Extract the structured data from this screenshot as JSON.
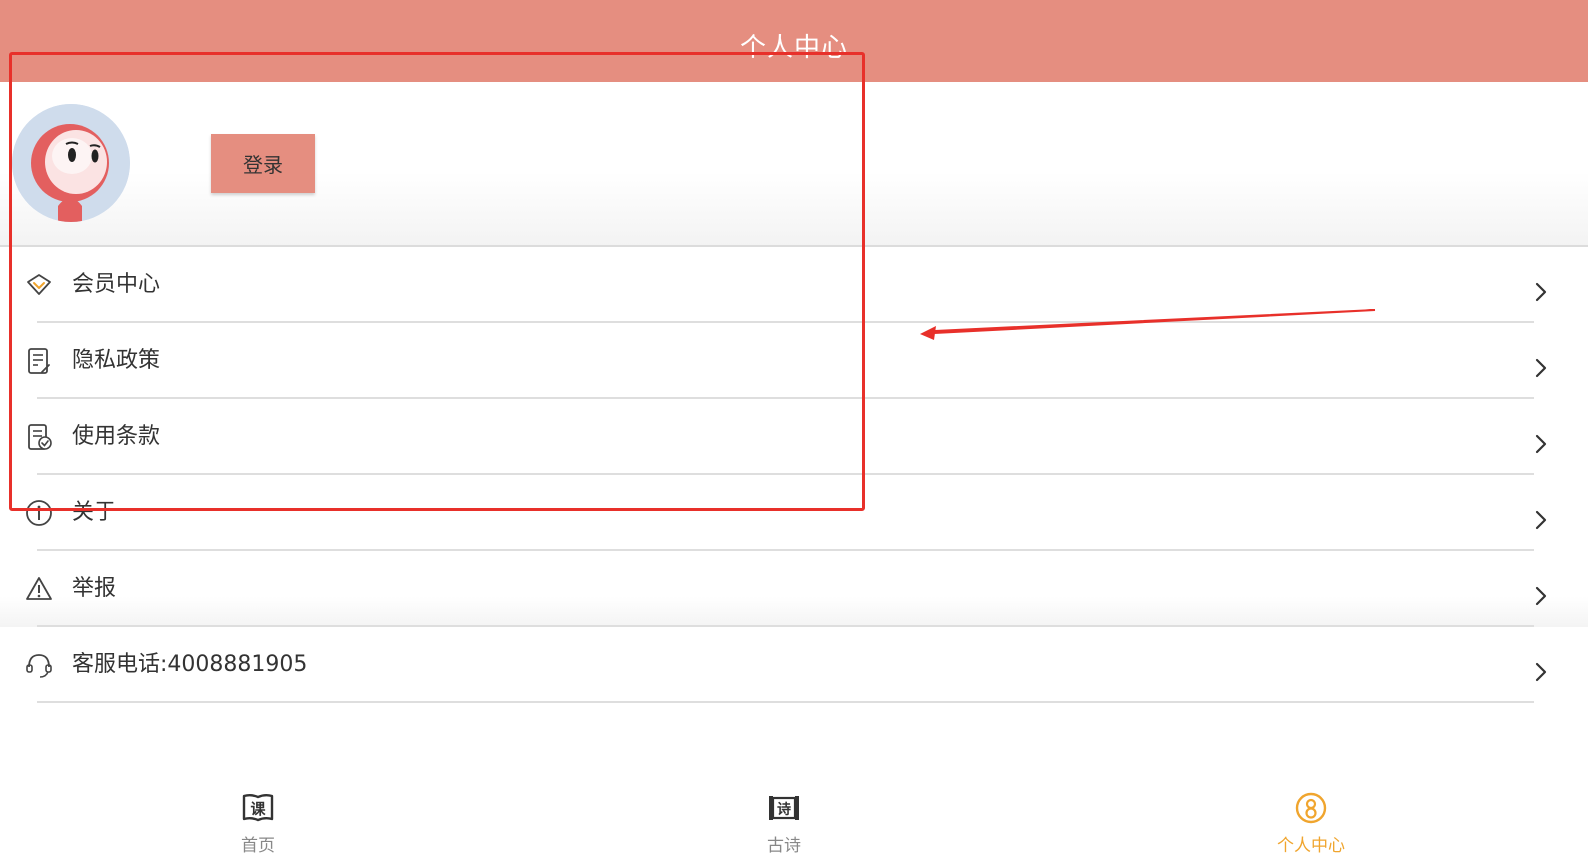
{
  "header": {
    "title": "个人中心"
  },
  "profile": {
    "login_label": "登录"
  },
  "menu": [
    {
      "label": "会员中心",
      "icon": "diamond-icon"
    },
    {
      "label": "隐私政策",
      "icon": "document-icon"
    },
    {
      "label": "使用条款",
      "icon": "document-check-icon"
    },
    {
      "label": "关于",
      "icon": "info-icon"
    },
    {
      "label": "举报",
      "icon": "warning-icon"
    },
    {
      "label": "客服电话:4008881905",
      "icon": "headset-icon"
    }
  ],
  "tabbar": {
    "tabs": [
      {
        "label": "首页",
        "icon": "course-book-icon",
        "active": false
      },
      {
        "label": "古诗",
        "icon": "poem-scroll-icon",
        "active": false
      },
      {
        "label": "个人中心",
        "icon": "user-circle-icon",
        "active": true
      }
    ]
  },
  "colors": {
    "brand": "#e58e80",
    "active_tab": "#f0a52e",
    "annotation": "#e8302a",
    "text": "#333333",
    "muted": "#888888"
  }
}
